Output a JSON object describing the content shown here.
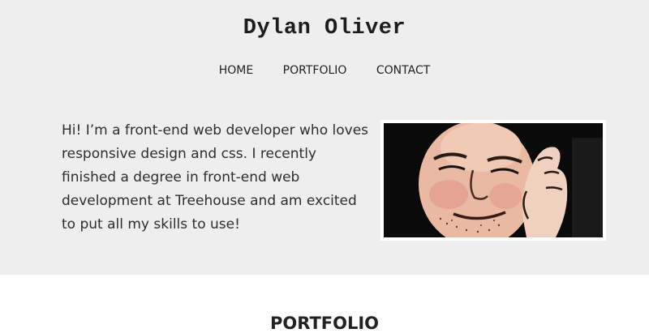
{
  "header": {
    "title": "Dylan Oliver"
  },
  "nav": {
    "items": [
      {
        "label": "HOME"
      },
      {
        "label": "PORTFOLIO"
      },
      {
        "label": "CONTACT"
      }
    ]
  },
  "hero": {
    "intro": "Hi! I’m a front-end web developer who loves responsive design and css. I recently finished a degree in front-end web development at Treehouse and am excited to put all my skills to use!"
  },
  "portfolio": {
    "heading": "PORTFOLIO"
  }
}
